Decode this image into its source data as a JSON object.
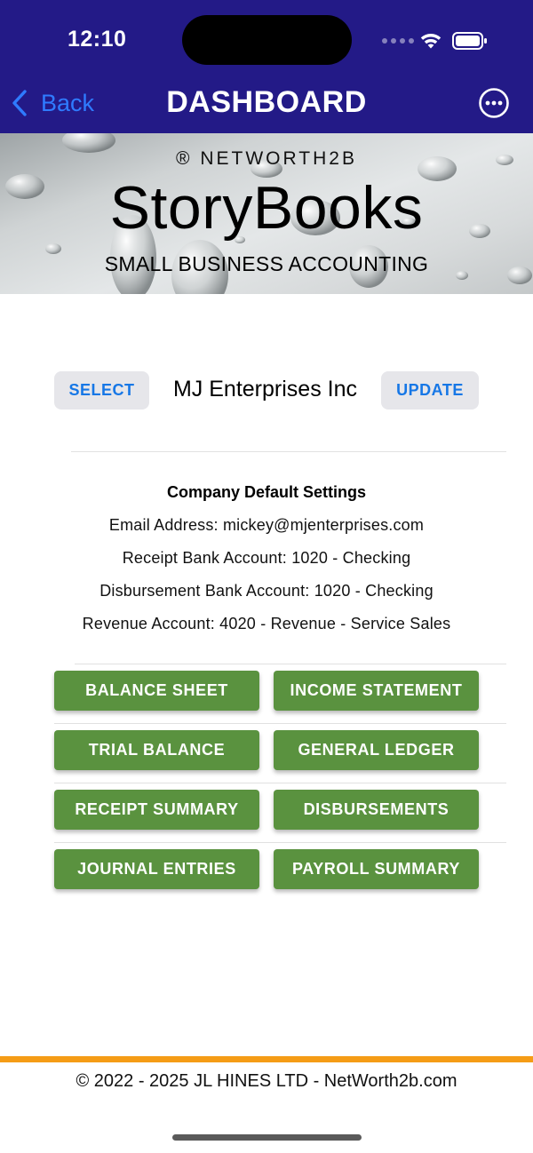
{
  "status_bar": {
    "time": "12:10"
  },
  "nav": {
    "back_label": "Back",
    "title": "DASHBOARD"
  },
  "banner": {
    "registered": "® NETWORTH2B",
    "title": "StoryBooks",
    "subtitle": "SMALL BUSINESS ACCOUNTING"
  },
  "company": {
    "select_label": "SELECT",
    "name": "MJ Enterprises Inc",
    "update_label": "UPDATE"
  },
  "settings": {
    "title": "Company Default Settings",
    "email": "Email Address: mickey@mjenterprises.com",
    "receipt_bank": "Receipt Bank Account: 1020 - Checking",
    "disbursement_bank": "Disbursement Bank Account: 1020 - Checking",
    "revenue_account": "Revenue Account: 4020 - Revenue - Service Sales"
  },
  "reports": [
    {
      "label": "BALANCE SHEET"
    },
    {
      "label": "INCOME STATEMENT"
    },
    {
      "label": "TRIAL BALANCE"
    },
    {
      "label": "GENERAL LEDGER"
    },
    {
      "label": "RECEIPT SUMMARY"
    },
    {
      "label": "DISBURSEMENTS"
    },
    {
      "label": "JOURNAL ENTRIES"
    },
    {
      "label": "PAYROLL SUMMARY"
    }
  ],
  "footer": {
    "copyright": "© 2022 - 2025 JL HINES LTD - NetWorth2b.com"
  },
  "colors": {
    "nav_bg": "#231a87",
    "link_blue": "#2f7bff",
    "button_green": "#5a923f",
    "footer_accent": "#f59c16"
  },
  "icons": {
    "back": "chevron-left-icon",
    "more": "ellipsis-circle-icon",
    "wifi": "wifi-icon",
    "battery": "battery-icon",
    "signal": "cellular-signal-icon"
  }
}
